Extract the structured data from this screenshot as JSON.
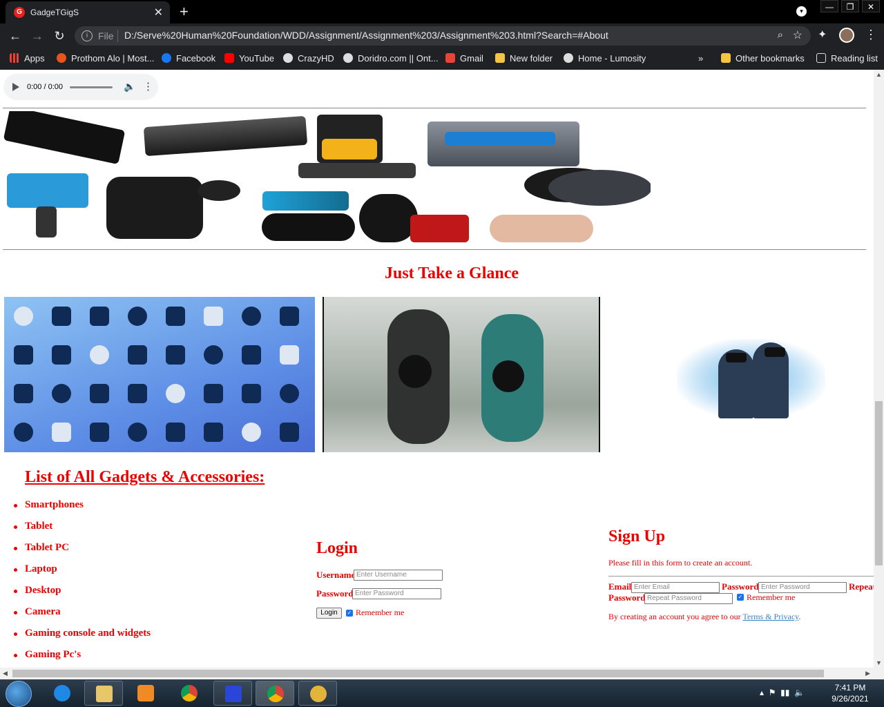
{
  "browser": {
    "tab_title": "GadgeTGigS",
    "tab_close": "✕",
    "new_tab": "+",
    "window_controls": [
      "—",
      "❐",
      "✕"
    ],
    "omnibox": {
      "scheme": "File",
      "url": "D:/Serve%20Human%20Foundation/WDD/Assignment/Assignment%203/Assignment%203.html?Search=#About"
    },
    "bookmarks": [
      {
        "label": "Apps",
        "color": "#ea4335"
      },
      {
        "label": "Prothom Alo | Most...",
        "color": "#e8541e"
      },
      {
        "label": "Facebook",
        "color": "#1877f2"
      },
      {
        "label": "YouTube",
        "color": "#ff0000"
      },
      {
        "label": "CrazyHD",
        "color": "#dddddd"
      },
      {
        "label": "Doridro.com || Ont...",
        "color": "#dddddd"
      },
      {
        "label": "Gmail",
        "color": "#ea4335"
      },
      {
        "label": "New folder",
        "color": "#f5c542"
      },
      {
        "label": "Home - Lumosity",
        "color": "#dddddd"
      },
      {
        "label": "»",
        "color": ""
      },
      {
        "label": "Other bookmarks",
        "color": "#f5c542"
      },
      {
        "label": "Reading list",
        "color": "#dddddd"
      }
    ]
  },
  "page": {
    "audio_time": "0:00 / 0:00",
    "glance_heading": "Just Take a Glance",
    "list_title": "List of All Gadgets & Accessories:",
    "gadgets": [
      "Smartphones",
      "Tablet",
      "Tablet PC",
      "Laptop",
      "Desktop",
      "Camera",
      "Gaming console and widgets",
      "Gaming Pc's"
    ],
    "login": {
      "title": "Login",
      "username_label": "Username",
      "username_placeholder": "Enter Username",
      "password_label": "Password",
      "password_placeholder": "Enter Password",
      "button": "Login",
      "remember": "Remember me"
    },
    "signup": {
      "title": "Sign Up",
      "subtitle": "Please fill in this form to create an account.",
      "email_label": "Email",
      "email_placeholder": "Enter Email",
      "password_label": "Password",
      "password_placeholder": "Enter Password",
      "repeat_label_1": "Repeat",
      "repeat_label_2": "Password",
      "repeat_placeholder": "Repeat Password",
      "remember": "Remember me",
      "terms_prefix": "By creating an account you agree to our ",
      "terms_link": "Terms & Privacy",
      "terms_suffix": "."
    }
  },
  "taskbar": {
    "time": "7:41 PM",
    "date": "9/26/2021"
  }
}
